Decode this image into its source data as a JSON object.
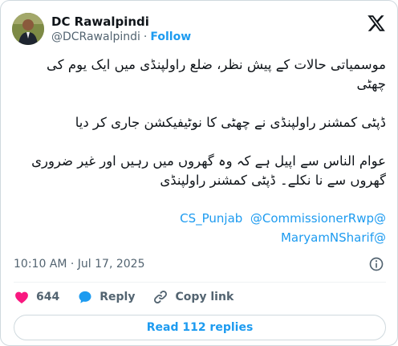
{
  "author": {
    "name": "DC Rawalpindi",
    "handle": "@DCRawalpindi",
    "separator": "·",
    "follow_label": "Follow"
  },
  "tweet": {
    "line1": "موسمیاتی حالات کے پیش نظر، ضلع راولپنڈی میں ایک یوم کی چھٹی",
    "line2": "ڈپٹی کمشنر راولپنڈی نے چھٹی کا نوٹیفیکشن جاری کر دیا",
    "line3": "عوام الناس سے اپیل ہے کہ وہ گھروں میں رہیں اور غیر ضروری گھروں سے نا نکلے۔ ڈپٹی کمشنر راولپنڈی",
    "mentions": [
      "@CommissionerRwp",
      "@CS_Punjab",
      "@MaryamNSharif"
    ]
  },
  "timestamp": "10:10 AM · Jul 17, 2025",
  "actions": {
    "like_count": "644",
    "reply_label": "Reply",
    "copy_label": "Copy link"
  },
  "read_replies_label": "Read 112 replies",
  "colors": {
    "accent": "#1d9bf0",
    "like": "#f91880",
    "text": "#0f1419",
    "muted": "#536471",
    "border": "#cfd9de"
  },
  "icons": [
    "x-logo-icon",
    "info-icon",
    "heart-icon",
    "reply-bubble-icon",
    "link-icon"
  ]
}
